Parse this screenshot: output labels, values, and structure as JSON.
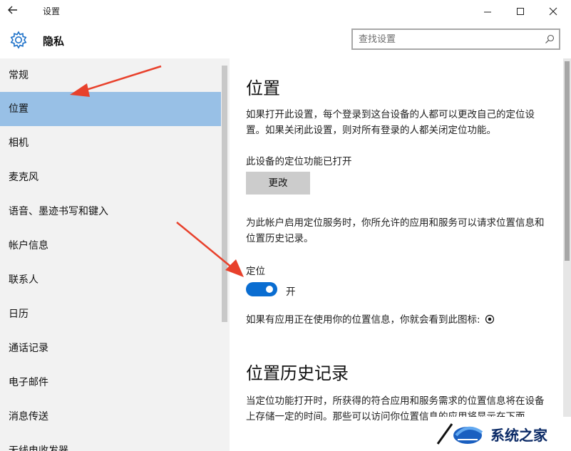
{
  "window": {
    "title": "设置",
    "controls": [
      "minimize",
      "maximize",
      "close"
    ]
  },
  "header": {
    "section_title": "隐私",
    "search_placeholder": "查找设置"
  },
  "sidebar": {
    "items": [
      {
        "label": "常规",
        "active": false
      },
      {
        "label": "位置",
        "active": true
      },
      {
        "label": "相机",
        "active": false
      },
      {
        "label": "麦克风",
        "active": false
      },
      {
        "label": "语音、墨迹书写和键入",
        "active": false
      },
      {
        "label": "帐户信息",
        "active": false
      },
      {
        "label": "联系人",
        "active": false
      },
      {
        "label": "日历",
        "active": false
      },
      {
        "label": "通话记录",
        "active": false
      },
      {
        "label": "电子邮件",
        "active": false
      },
      {
        "label": "消息传送",
        "active": false
      },
      {
        "label": "无线电收发器",
        "active": false
      }
    ]
  },
  "main": {
    "title": "位置",
    "intro": "如果打开此设置，每个登录到这台设备的人都可以更改自己的定位设置。如果关闭此设置，则对所有登录的人都关闭定位功能。",
    "device_status": "此设备的定位功能已打开",
    "change_button": "更改",
    "account_desc": "为此帐户启用定位服务时，你所允许的应用和服务可以请求位置信息和位置历史记录。",
    "location_label": "定位",
    "toggle_state": "开",
    "toggle_on": true,
    "icon_note": "如果有应用正在使用你的位置信息，你就会看到此图标:",
    "history_title": "位置历史记录",
    "history_desc": "当定位功能打开时，所获得的符合应用和服务需求的位置信息将在设备上存储一定的时间。那些可以访问你位置信息的应用将显示在下面。"
  },
  "watermark": {
    "text": "系统之家"
  },
  "colors": {
    "accent": "#0a6dd1",
    "active_nav": "#98c0e6",
    "sidebar_bg": "#f2f2f2",
    "annotation_arrow": "#e8412c"
  }
}
